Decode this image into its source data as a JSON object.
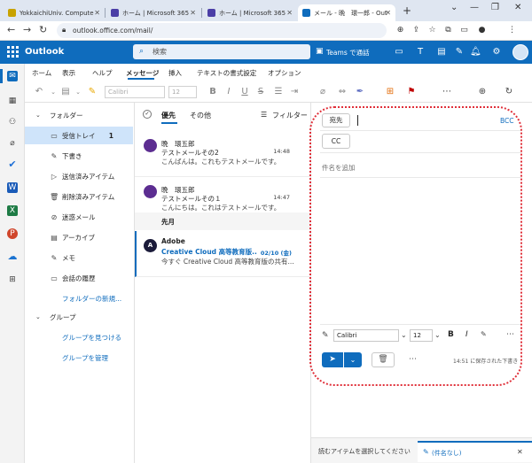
{
  "browser": {
    "tabs": [
      {
        "title": "YokkaichiUniv. Compute",
        "favicon_color": "#c8a200",
        "active": false
      },
      {
        "title": "ホーム | Microsoft 365",
        "favicon_color": "#4b3ea6",
        "active": false
      },
      {
        "title": "ホーム | Microsoft 365",
        "favicon_color": "#4b3ea6",
        "active": false
      },
      {
        "title": "メール - 晩　環一郎 - Out",
        "favicon_color": "#0f6cbd",
        "active": true
      }
    ],
    "new_tab": "+",
    "url": "outlook.office.com/mail/"
  },
  "app": {
    "brand": "Outlook",
    "search_placeholder": "検索",
    "teams_label": "Teams で通話"
  },
  "ribbon": {
    "tabs": [
      "ホーム",
      "表示",
      "ヘルプ",
      "メッセージ",
      "挿入",
      "テキストの書式設定",
      "オプション"
    ],
    "selected_tab": "メッセージ",
    "font": "Calibri",
    "size": "12"
  },
  "folders": {
    "header": "フォルダー",
    "items": [
      {
        "label": "受信トレイ",
        "icon": "inbox-icon",
        "count": "1",
        "selected": true
      },
      {
        "label": "下書き",
        "icon": "pencil-icon",
        "count": ""
      },
      {
        "label": "送信済みアイテム",
        "icon": "send-icon",
        "count": ""
      },
      {
        "label": "削除済みアイテム",
        "icon": "trash-icon",
        "count": ""
      },
      {
        "label": "迷惑メール",
        "icon": "junk-icon",
        "count": ""
      },
      {
        "label": "アーカイブ",
        "icon": "archive-icon",
        "count": ""
      },
      {
        "label": "メモ",
        "icon": "note-icon",
        "count": ""
      },
      {
        "label": "会話の履歴",
        "icon": "history-icon",
        "count": ""
      }
    ],
    "new_folder": "フォルダーの新規...",
    "groups_header": "グループ",
    "find_groups": "グループを見つける",
    "manage_groups": "グループを管理"
  },
  "message_list": {
    "tab_focused": "優先",
    "tab_other": "その他",
    "filter": "フィルター",
    "section_last_month": "先月",
    "messages": [
      {
        "avatar_letter": "",
        "avatar_color": "#5c2d91",
        "sender": "晩　環五郎",
        "subject": "テストメールその2",
        "preview": "こんばんは。これもテストメールです。",
        "time": "14:48",
        "unread": false
      },
      {
        "avatar_letter": "",
        "avatar_color": "#5c2d91",
        "sender": "晩　環五郎",
        "subject": "テストメールその１",
        "preview": "こんにちは。これはテストメールです。",
        "time": "14:47",
        "unread": false
      },
      {
        "avatar_letter": "A",
        "avatar_color": "#1b1b3a",
        "sender": "Adobe",
        "subject": "Creative Cloud 高等教育版...",
        "preview": "今すぐ Creative Cloud 高等教育版の共有...",
        "time": "02/10 (金)",
        "unread": true
      }
    ]
  },
  "compose": {
    "to_label": "宛先",
    "cc_label": "CC",
    "bcc_label": "BCC",
    "subject_placeholder": "件名を追加",
    "font": "Calibri",
    "size": "12",
    "bold": "B",
    "italic": "I",
    "saved_status": "14:51 に保存された下書き"
  },
  "bottombar": {
    "select_item": "読むアイテムを選択してください",
    "draft_tab": "(件名なし)"
  }
}
